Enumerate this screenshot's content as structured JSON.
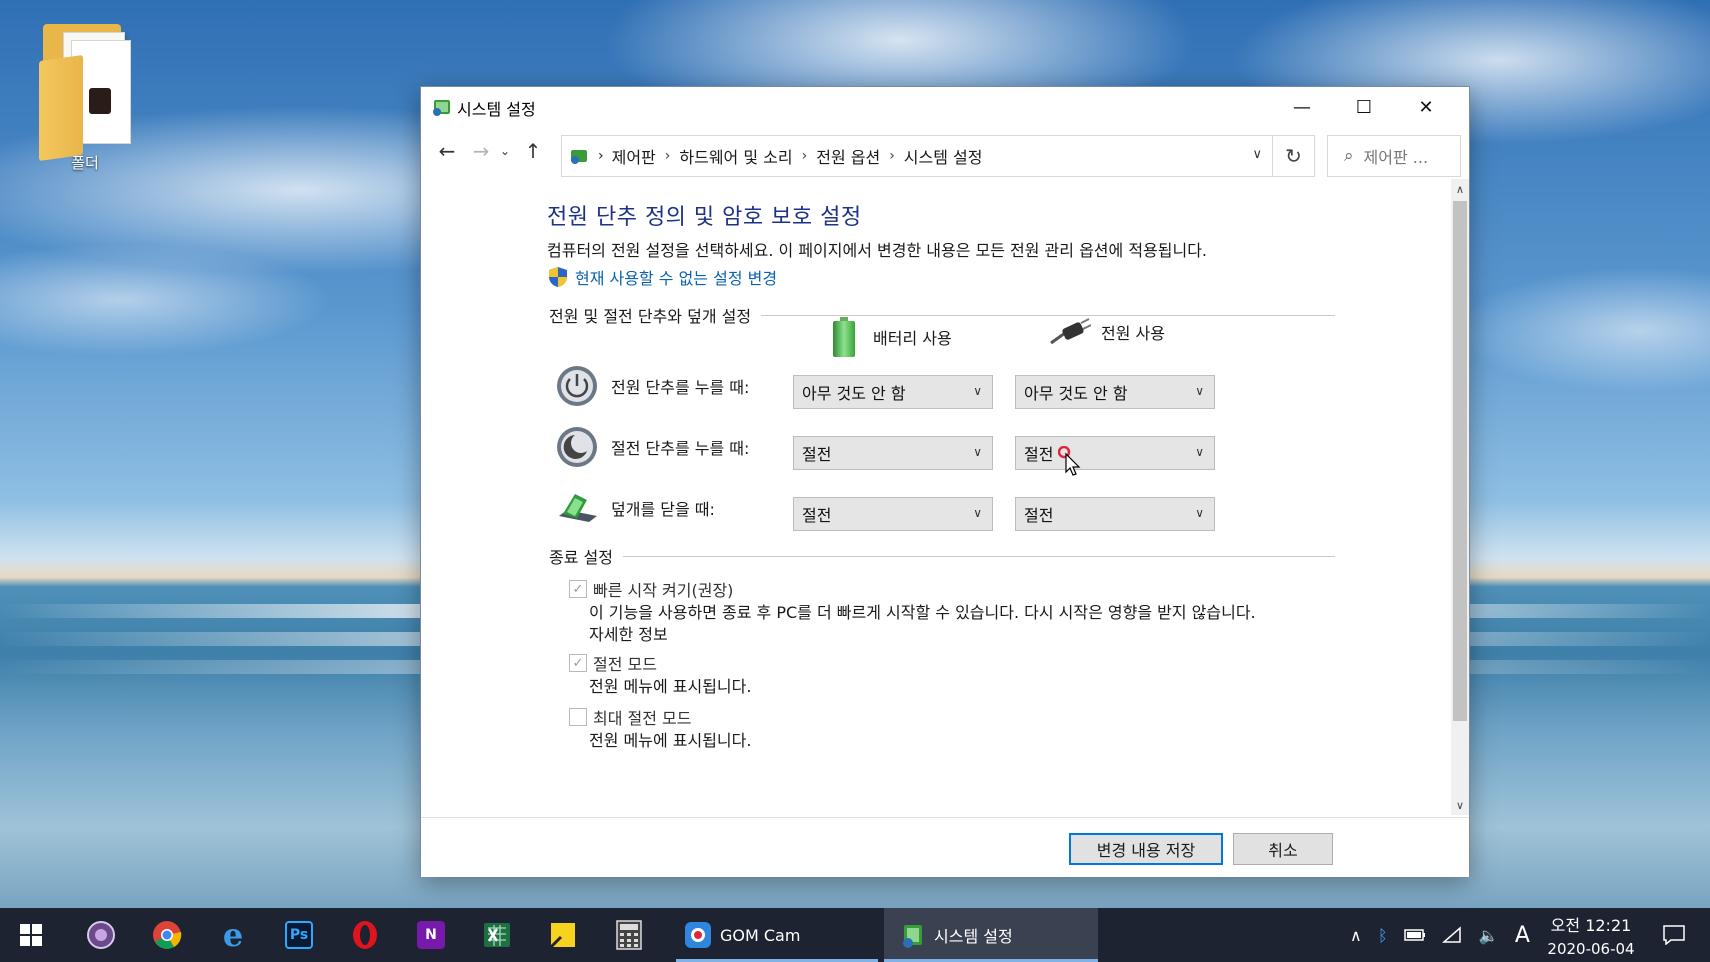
{
  "desktop": {
    "icons": [
      {
        "label": "폴더"
      }
    ]
  },
  "window": {
    "title": "시스템 설정",
    "controls": {
      "minimize": "—",
      "maximize": "☐",
      "close": "✕"
    },
    "breadcrumb": [
      "제어판",
      "하드웨어 및 소리",
      "전원 옵션",
      "시스템 설정"
    ],
    "search_placeholder": "제어판 ...",
    "page": {
      "title": "전원 단추 정의 및 암호 보호 설정",
      "description": "컴퓨터의 전원 설정을 선택하세요. 이 페이지에서 변경한 내용은 모든 전원 관리 옵션에 적용됩니다.",
      "admin_link": "현재 사용할 수 없는 설정 변경",
      "section_buttons": "전원 및 절전 단추와 덮개 설정",
      "col_battery": "배터리 사용",
      "col_power": "전원 사용",
      "rows": [
        {
          "label": "전원 단추를 누를 때:",
          "battery": "아무 것도 안 함",
          "power": "아무 것도 안 함"
        },
        {
          "label": "절전 단추를 누를 때:",
          "battery": "절전",
          "power": "절전"
        },
        {
          "label": "덮개를 닫을 때:",
          "battery": "절전",
          "power": "절전"
        }
      ],
      "section_shutdown": "종료 설정",
      "shutdown_options": [
        {
          "label": "빠른 시작 켜기(권장)",
          "checked": true,
          "desc": "이 기능을 사용하면 종료 후 PC를 더 빠르게 시작할 수 있습니다. 다시 시작은 영향을 받지 않습니다.",
          "link": "자세한 정보"
        },
        {
          "label": "절전 모드",
          "checked": true,
          "desc": "전원 메뉴에 표시됩니다."
        },
        {
          "label": "최대 절전 모드",
          "checked": false,
          "desc": "전원 메뉴에 표시됩니다."
        }
      ]
    },
    "buttons": {
      "save": "변경 내용 저장",
      "cancel": "취소"
    }
  },
  "taskbar": {
    "apps": [
      {
        "name": "start",
        "icon": "windows-logo-icon"
      },
      {
        "name": "app-purple",
        "icon": "circle-app-icon"
      },
      {
        "name": "chrome",
        "icon": "chrome-icon"
      },
      {
        "name": "edge",
        "icon": "edge-icon"
      },
      {
        "name": "photoshop",
        "icon": "photoshop-icon",
        "text": "Ps"
      },
      {
        "name": "opera",
        "icon": "opera-icon"
      },
      {
        "name": "onenote",
        "icon": "onenote-icon",
        "text": "N"
      },
      {
        "name": "excel",
        "icon": "excel-icon"
      },
      {
        "name": "sticky",
        "icon": "sticky-notes-icon"
      },
      {
        "name": "calculator",
        "icon": "calculator-icon"
      }
    ],
    "gom_cam": "GOM Cam",
    "active_window": "시스템 설정",
    "tray": {
      "ime": "A"
    },
    "clock": {
      "time": "오전 12:21",
      "date": "2020-06-04"
    }
  },
  "colors": {
    "title_blue": "#1e3287",
    "link_blue": "#0b62b0",
    "taskbar": "#1d2330",
    "accent": "#0078d7"
  }
}
